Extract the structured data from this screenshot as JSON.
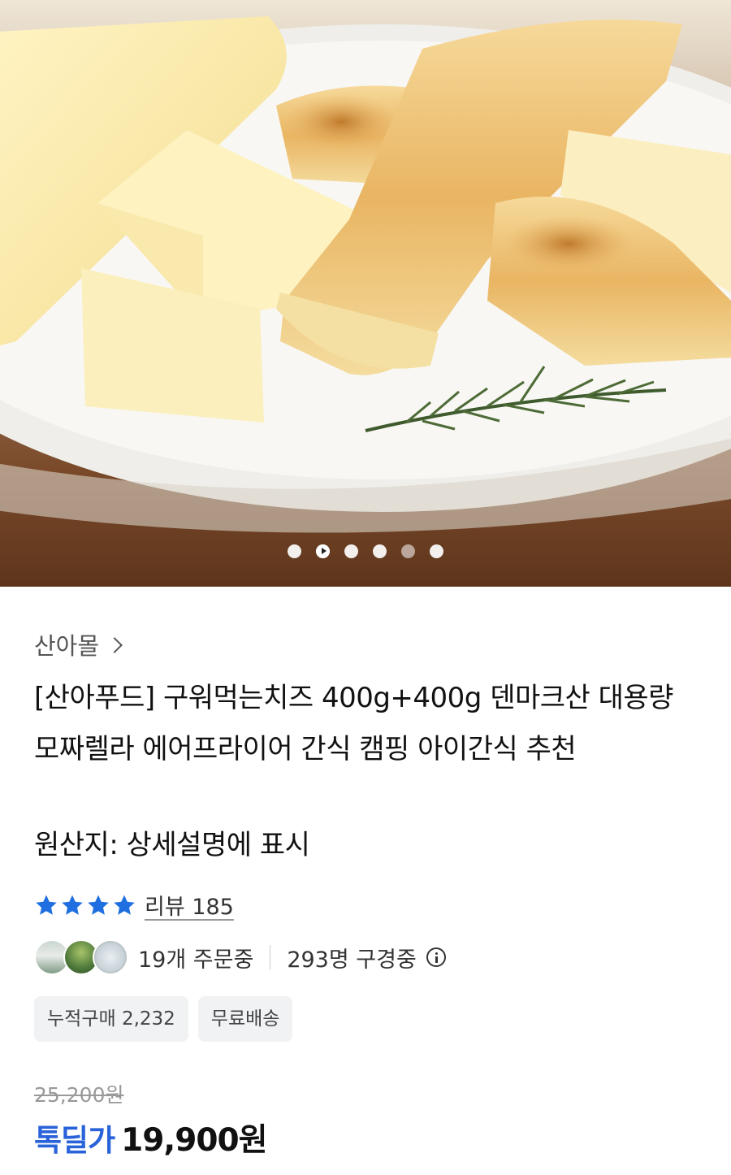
{
  "carousel": {
    "dots": [
      "dot-1",
      "play",
      "dot-3",
      "dot-4",
      "dot-5",
      "dot-6"
    ]
  },
  "store": {
    "name": "산아몰"
  },
  "product": {
    "title": "[산아푸드] 구워먹는치즈 400g+400g 덴마크산 대용량 모짜렐라 에어프라이어 간식 캠핑 아이간식 추천",
    "origin": "원산지: 상세설명에 표시"
  },
  "rating": {
    "stars": 4,
    "review_label": "리뷰 185"
  },
  "activity": {
    "orders": "19개 주문중",
    "viewers": "293명 구경중"
  },
  "badges": {
    "cumulative": "누적구매 2,232",
    "free_shipping": "무료배송"
  },
  "price": {
    "original": "25,200원",
    "deal_label": "톡딜가",
    "sale": "19,900원"
  },
  "colors": {
    "accent": "#2a63d9",
    "star": "#1f6fe0"
  }
}
